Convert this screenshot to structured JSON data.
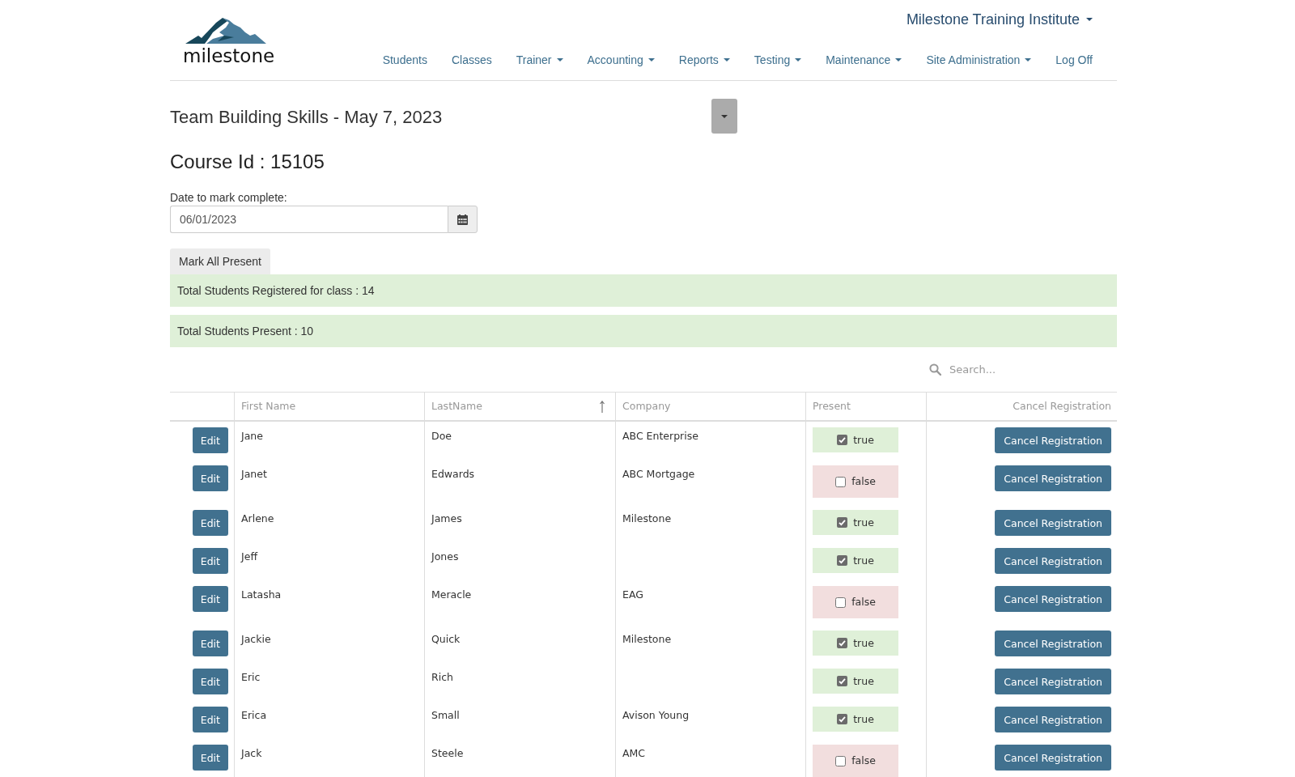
{
  "header": {
    "logo_text": "milestone",
    "brand": {
      "label": "Milestone Training Institute",
      "dropdown": true
    },
    "nav": [
      {
        "label": "Students",
        "dropdown": false
      },
      {
        "label": "Classes",
        "dropdown": false
      },
      {
        "label": "Trainer",
        "dropdown": true
      },
      {
        "label": "Accounting",
        "dropdown": true
      },
      {
        "label": "Reports",
        "dropdown": true
      },
      {
        "label": "Testing",
        "dropdown": true
      },
      {
        "label": "Maintenance",
        "dropdown": true
      },
      {
        "label": "Site Administration",
        "dropdown": true
      },
      {
        "label": "Log Off",
        "dropdown": false
      }
    ]
  },
  "course": {
    "title": "Team Building Skills - May 7, 2023",
    "course_id": "Course Id : 15105",
    "date_field": {
      "label": "Date to mark complete:",
      "value": "06/01/2023"
    },
    "mark_all_button": "Mark All Present",
    "alerts": [
      "Total Students Registered for class : 14",
      "Total Students Present : 10"
    ]
  },
  "search": {
    "placeholder": "Search..."
  },
  "table": {
    "columns": [
      {
        "label": "First Name",
        "sorted": false
      },
      {
        "label": "LastName",
        "sorted": true
      },
      {
        "label": "Company",
        "sorted": false
      },
      {
        "label": "Present",
        "sorted": false
      },
      {
        "label": "Cancel Registration",
        "sorted": false
      }
    ],
    "rows": [
      {
        "edit_button": "Edit",
        "first_name": "Jane",
        "last_name": "Doe",
        "company": "ABC Enterprise",
        "present": true,
        "present_label": "true",
        "cancel_button": "Cancel Registration"
      },
      {
        "edit_button": "Edit",
        "first_name": "Janet",
        "last_name": "Edwards",
        "company": "ABC Mortgage",
        "present": false,
        "present_label": "false",
        "cancel_button": "Cancel Registration"
      },
      {
        "edit_button": "Edit",
        "first_name": "Arlene",
        "last_name": "James",
        "company": "Milestone",
        "present": true,
        "present_label": "true",
        "cancel_button": "Cancel Registration"
      },
      {
        "edit_button": "Edit",
        "first_name": "Jeff",
        "last_name": "Jones",
        "present": true,
        "present_label": "true",
        "cancel_button": "Cancel Registration"
      },
      {
        "edit_button": "Edit",
        "first_name": "Latasha",
        "last_name": "Meracle",
        "company": "EAG",
        "present": false,
        "present_label": "false",
        "cancel_button": "Cancel Registration"
      },
      {
        "edit_button": "Edit",
        "first_name": "Jackie",
        "last_name": "Quick",
        "company": "Milestone",
        "present": true,
        "present_label": "true",
        "cancel_button": "Cancel Registration"
      },
      {
        "edit_button": "Edit",
        "first_name": "Eric",
        "last_name": "Rich",
        "present": true,
        "present_label": "true",
        "cancel_button": "Cancel Registration"
      },
      {
        "edit_button": "Edit",
        "first_name": "Erica",
        "last_name": "Small",
        "company": "Avison Young",
        "present": true,
        "present_label": "true",
        "cancel_button": "Cancel Registration"
      },
      {
        "edit_button": "Edit",
        "first_name": "Jack",
        "last_name": "Steele",
        "company": "AMC",
        "present": false,
        "present_label": "false",
        "cancel_button": "Cancel Registration"
      }
    ]
  }
}
